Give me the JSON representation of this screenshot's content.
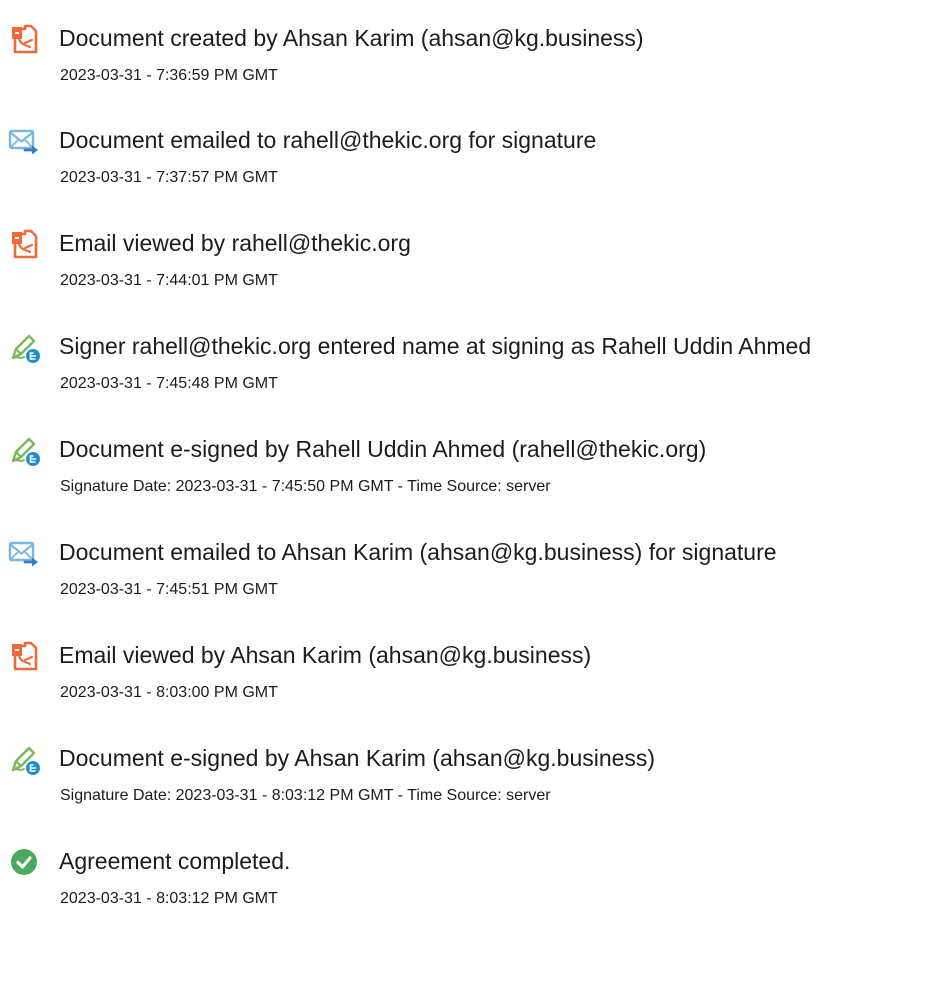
{
  "events": [
    {
      "icon": "pdf-document-icon",
      "description": "Document created by Ahsan Karim (ahsan@kg.business)",
      "timestamp": "2023-03-31 - 7:36:59 PM GMT"
    },
    {
      "icon": "email-send-icon",
      "description": "Document emailed to rahell@thekic.org for signature",
      "timestamp": "2023-03-31 - 7:37:57 PM GMT"
    },
    {
      "icon": "pdf-document-icon",
      "description": "Email viewed by rahell@thekic.org",
      "timestamp": "2023-03-31 - 7:44:01 PM GMT"
    },
    {
      "icon": "pen-sign-icon",
      "description": "Signer rahell@thekic.org entered name at signing as Rahell Uddin Ahmed",
      "timestamp": "2023-03-31 - 7:45:48 PM GMT"
    },
    {
      "icon": "pen-sign-icon",
      "description": "Document e-signed by Rahell Uddin Ahmed (rahell@thekic.org)",
      "timestamp": "Signature Date: 2023-03-31 - 7:45:50 PM GMT - Time Source: server"
    },
    {
      "icon": "email-send-icon",
      "description": "Document emailed to Ahsan Karim (ahsan@kg.business) for signature",
      "timestamp": "2023-03-31 - 7:45:51 PM GMT"
    },
    {
      "icon": "pdf-document-icon",
      "description": "Email viewed by Ahsan Karim (ahsan@kg.business)",
      "timestamp": "2023-03-31 - 8:03:00 PM GMT"
    },
    {
      "icon": "pen-sign-icon",
      "description": "Document e-signed by Ahsan Karim (ahsan@kg.business)",
      "timestamp": "Signature Date: 2023-03-31 - 8:03:12 PM GMT - Time Source: server"
    },
    {
      "icon": "check-circle-icon",
      "description": "Agreement completed.",
      "timestamp": "2023-03-31 - 8:03:12 PM GMT"
    }
  ],
  "colors": {
    "pdf_icon": "#ef6a3a",
    "email_icon": "#7ab6e0",
    "email_arrow": "#2f7fc4",
    "pen_icon": "#7ab85a",
    "pen_badge": "#1f8ecf",
    "check_icon": "#4aab5f"
  }
}
